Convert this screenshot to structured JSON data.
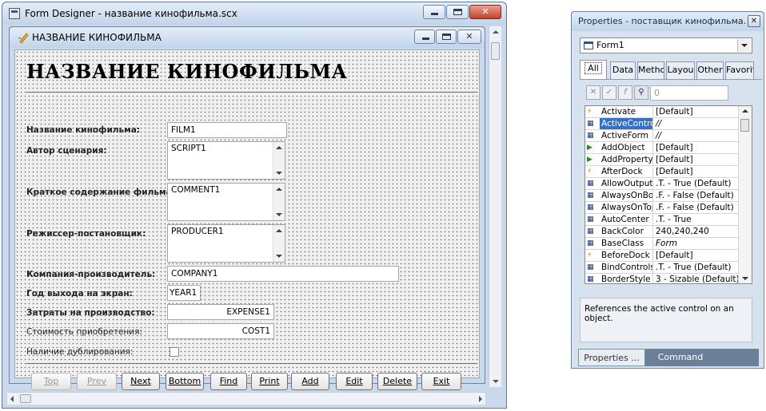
{
  "designer": {
    "title": "Form Designer - название кинофильма.scx",
    "child_title": "НАЗВАНИЕ КИНОФИЛЬМА",
    "heading": "НАЗВАНИЕ КИНОФИЛЬМА",
    "fields": [
      {
        "label": "Название кинофильма:",
        "value": "FILM1"
      },
      {
        "label": "Автор сценария:",
        "value": "SCRIPT1"
      },
      {
        "label": "Краткое содержание фильма:",
        "value": "COMMENT1"
      },
      {
        "label": "Режиссер-постановщик:",
        "value": "PRODUCER1"
      },
      {
        "label": "Компания-производитель:",
        "value": "COMPANY1"
      },
      {
        "label": "Год выхода на экран:",
        "value": "YEAR1"
      },
      {
        "label": "Затраты на производство:",
        "value": "EXPENSE1"
      },
      {
        "label": "Стоимость приобретения:",
        "value": "COST1"
      },
      {
        "label": "Наличие дублирования:",
        "value": ""
      }
    ],
    "buttons": [
      "Top",
      "Prev",
      "Next",
      "Bottom",
      "Find",
      "Print",
      "Add",
      "Edit",
      "Delete",
      "Exit"
    ],
    "disabled_buttons": [
      "Top",
      "Prev"
    ]
  },
  "properties": {
    "title": "Properties - поставщик кинофильма.scx",
    "object": "Form1",
    "tabs": [
      "All",
      "Data",
      "Metho",
      "Layou",
      "Other",
      "Favorit"
    ],
    "active_tab": "All",
    "value_box": "0",
    "rows": [
      {
        "name": "Activate",
        "value": "[Default]",
        "icon": "event-icon"
      },
      {
        "name": "ActiveControl",
        "value": "//",
        "icon": "property-icon",
        "selected": true
      },
      {
        "name": "ActiveForm",
        "value": "//",
        "icon": "property-icon"
      },
      {
        "name": "AddObject",
        "value": "[Default]",
        "icon": "method-icon"
      },
      {
        "name": "AddProperty",
        "value": "[Default]",
        "icon": "method-icon"
      },
      {
        "name": "AfterDock",
        "value": "[Default]",
        "icon": "event-icon"
      },
      {
        "name": "AllowOutput",
        "value": ".T. - True (Default)",
        "icon": "property-icon"
      },
      {
        "name": "AlwaysOnBottom",
        "value": ".F. - False (Default)",
        "icon": "property-icon"
      },
      {
        "name": "AlwaysOnTop",
        "value": ".F. - False (Default)",
        "icon": "property-icon"
      },
      {
        "name": "AutoCenter",
        "value": ".T. - True",
        "icon": "property-icon"
      },
      {
        "name": "BackColor",
        "value": "240,240,240",
        "icon": "property-icon"
      },
      {
        "name": "BaseClass",
        "value": "Form",
        "icon": "property-icon"
      },
      {
        "name": "BeforeDock",
        "value": "[Default]",
        "icon": "event-icon"
      },
      {
        "name": "BindControls",
        "value": ".T. - True (Default)",
        "icon": "property-icon"
      },
      {
        "name": "BorderStyle",
        "value": "3 - Sizable (Default)",
        "icon": "property-icon"
      }
    ],
    "description": "References the active control on an object.",
    "bottom_tabs": [
      "Properties ...",
      "Command"
    ]
  }
}
